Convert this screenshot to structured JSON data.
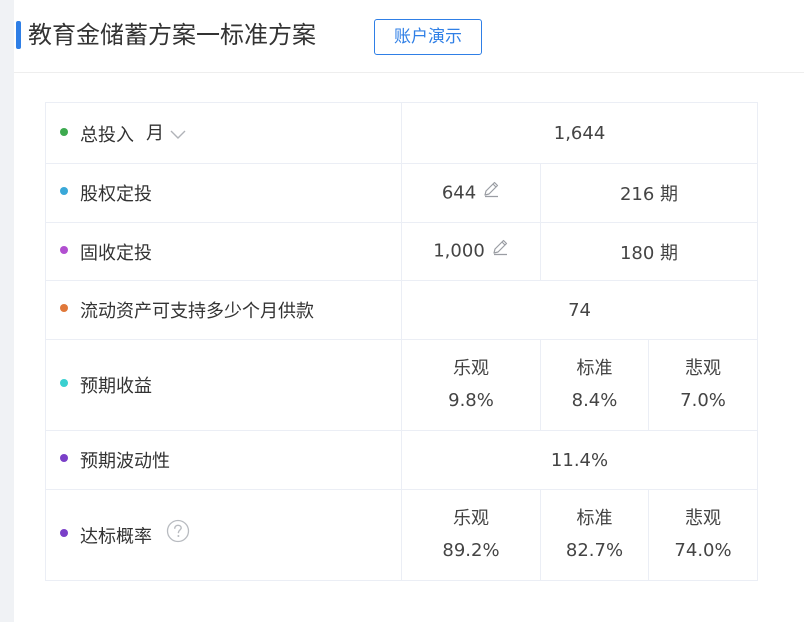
{
  "header": {
    "title": "教育金储蓄方案一标准方案",
    "demo_button": "账户演示"
  },
  "colors": {
    "accent": "#2f7fe6",
    "dot_total": "#3daa4f",
    "dot_equity": "#3aa8d8",
    "dot_fixed": "#b14fd0",
    "dot_liquid": "#e0783a",
    "dot_expected_return": "#3ad0d0",
    "dot_volatility": "#7a3fc8",
    "dot_probability": "#7a3fc8"
  },
  "rows": {
    "total": {
      "label": "总投入",
      "unit": "月",
      "value": "1,644"
    },
    "equity": {
      "label": "股权定投",
      "amount": "644",
      "periods": "216 期"
    },
    "fixed": {
      "label": "固收定投",
      "amount": "1,000",
      "periods": "180 期"
    },
    "liquid": {
      "label": "流动资产可支持多少个月供款",
      "value": "74"
    },
    "expected_return": {
      "label": "预期收益",
      "scenarios": [
        {
          "name": "乐观",
          "value": "9.8%"
        },
        {
          "name": "标准",
          "value": "8.4%"
        },
        {
          "name": "悲观",
          "value": "7.0%"
        }
      ]
    },
    "volatility": {
      "label": "预期波动性",
      "value": "11.4%"
    },
    "probability": {
      "label": "达标概率",
      "scenarios": [
        {
          "name": "乐观",
          "value": "89.2%"
        },
        {
          "name": "标准",
          "value": "82.7%"
        },
        {
          "name": "悲观",
          "value": "74.0%"
        }
      ]
    }
  },
  "icons": {
    "chevron": "chevron-down-icon",
    "edit": "pencil-icon",
    "help": "question-circle-icon"
  }
}
